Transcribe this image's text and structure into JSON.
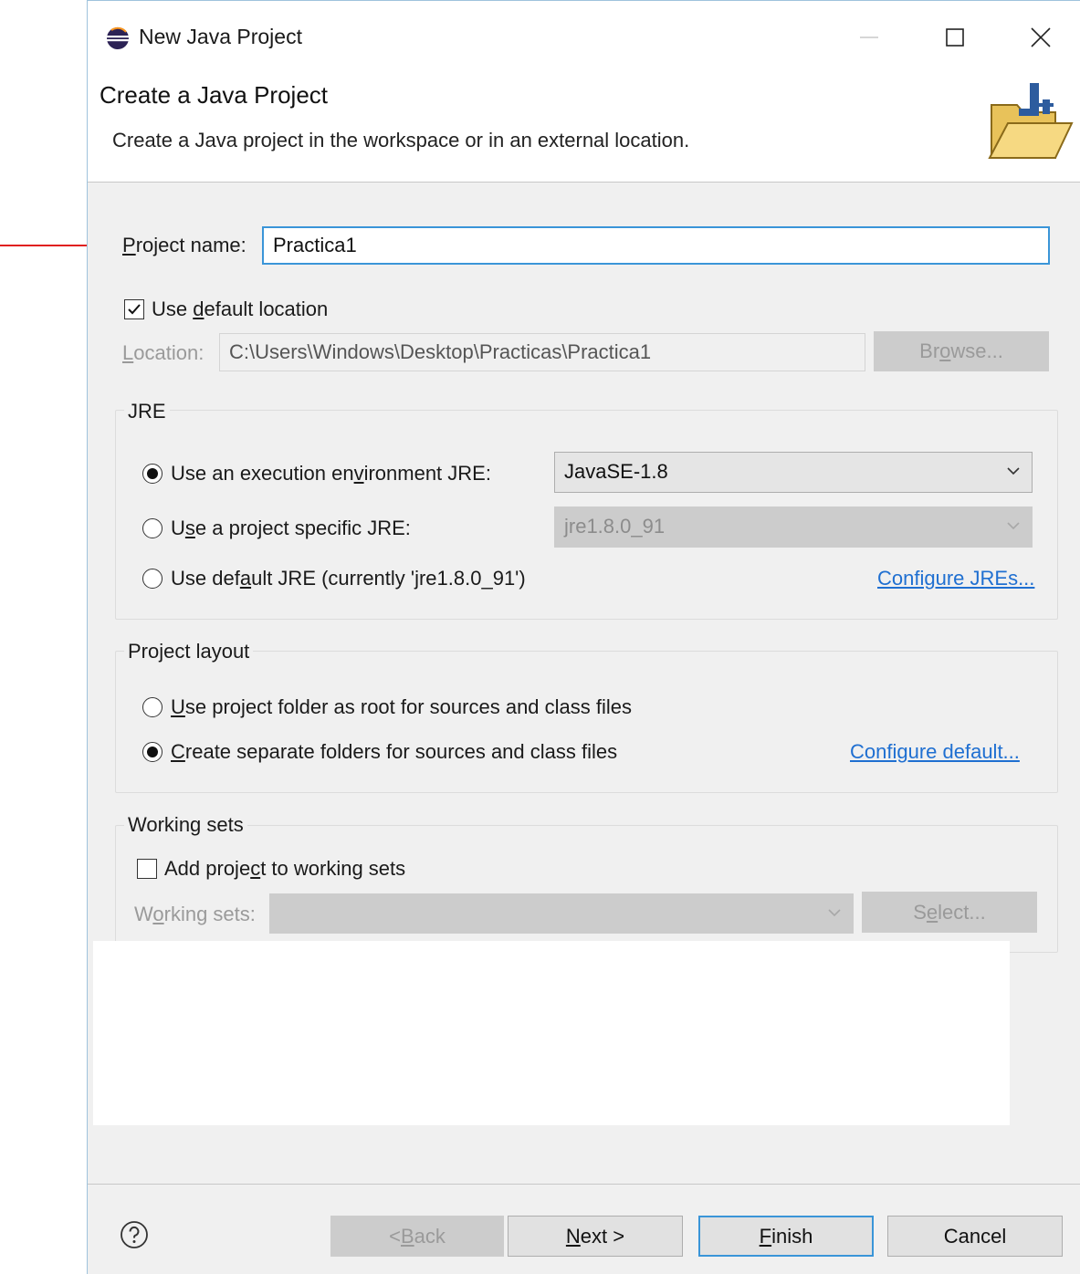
{
  "window": {
    "title": "New Java Project",
    "icon": "eclipse-icon"
  },
  "header": {
    "title": "Create a Java Project",
    "description": "Create a Java project in the workspace or in an external location.",
    "icon": "new-java-project-folder-icon"
  },
  "project_name": {
    "label_mnemonic": "P",
    "label_rest": "roject name:",
    "value": "Practica1"
  },
  "location": {
    "use_default_pre": "Use ",
    "use_default_mnemonic": "d",
    "use_default_post": "efault location",
    "use_default_checked": true,
    "label_mnemonic": "L",
    "label_rest": "ocation:",
    "value": "C:\\Users\\Windows\\Desktop\\Practicas\\Practica1",
    "browse_pre": "Br",
    "browse_mnemonic": "o",
    "browse_post": "wse..."
  },
  "jre": {
    "group_title": "JRE",
    "options": [
      {
        "pre": "Use an execution en",
        "mnemonic": "v",
        "post": "ironment JRE:",
        "selected": true
      },
      {
        "pre": "U",
        "mnemonic": "s",
        "post": "e a project specific JRE:",
        "selected": false
      },
      {
        "pre": "Use def",
        "mnemonic": "a",
        "post": "ult JRE (currently 'jre1.8.0_91')",
        "selected": false
      }
    ],
    "env_combo_value": "JavaSE-1.8",
    "specific_combo_value": "jre1.8.0_91",
    "configure_link": "Configure JREs..."
  },
  "layout": {
    "group_title": "Project layout",
    "options": [
      {
        "pre": "",
        "mnemonic": "U",
        "post": "se project folder as root for sources and class files",
        "selected": false
      },
      {
        "pre": "",
        "mnemonic": "C",
        "post": "reate separate folders for sources and class files",
        "selected": true
      }
    ],
    "configure_link": "Configure default..."
  },
  "working_sets": {
    "group_title": "Working sets",
    "add_pre": "Add proje",
    "add_mnemonic": "c",
    "add_post": "t to working sets",
    "add_checked": false,
    "label_pre": "W",
    "label_mnemonic": "o",
    "label_post": "rking sets:",
    "select_pre": "S",
    "select_mnemonic": "e",
    "select_post": "lect..."
  },
  "footer": {
    "back_pre": "< ",
    "back_mnemonic": "B",
    "back_post": "ack",
    "next_mnemonic": "N",
    "next_post": "ext >",
    "finish_mnemonic": "F",
    "finish_post": "inish",
    "cancel": "Cancel"
  },
  "colors": {
    "accent": "#3a95d8",
    "link": "#1f6fd1",
    "annotation_arrow": "#e0201f"
  }
}
